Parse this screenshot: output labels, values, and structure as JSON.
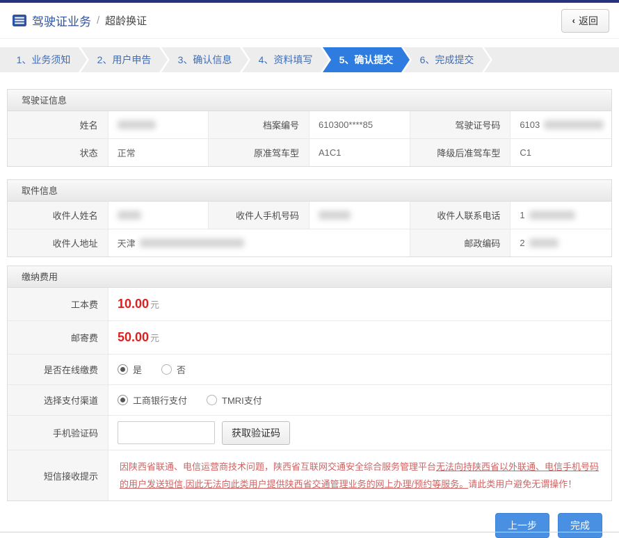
{
  "header": {
    "title": "驾驶证业务",
    "separator": "/",
    "subtitle": "超龄换证",
    "back_icon": "‹",
    "back_label": "返回"
  },
  "steps": [
    {
      "label": "1、业务须知",
      "active": false
    },
    {
      "label": "2、用户申告",
      "active": false
    },
    {
      "label": "3、确认信息",
      "active": false
    },
    {
      "label": "4、资料填写",
      "active": false
    },
    {
      "label": "5、确认提交",
      "active": true
    },
    {
      "label": "6、完成提交",
      "active": false
    }
  ],
  "license": {
    "title": "驾驶证信息",
    "name_label": "姓名",
    "file_no_label": "档案编号",
    "file_no_value": "610300****85",
    "license_no_label": "驾驶证号码",
    "license_no_prefix": "6103",
    "status_label": "状态",
    "status_value": "正常",
    "orig_class_label": "原准驾车型",
    "orig_class_value": "A1C1",
    "downgrade_class_label": "降级后准驾车型",
    "downgrade_class_value": "C1"
  },
  "pickup": {
    "title": "取件信息",
    "name_label": "收件人姓名",
    "mobile_label": "收件人手机号码",
    "phone_label": "收件人联系电话",
    "phone_prefix": "1",
    "address_label": "收件人地址",
    "address_prefix": "天津",
    "postcode_label": "邮政编码",
    "postcode_prefix": "2"
  },
  "payment": {
    "title": "缴纳费用",
    "fee_label": "工本费",
    "fee_value": "10.00",
    "fee_unit": "元",
    "postage_label": "邮寄费",
    "postage_value": "50.00",
    "postage_unit": "元",
    "online_label": "是否在线缴费",
    "online_yes": "是",
    "online_no": "否",
    "channel_label": "选择支付渠道",
    "channel_icbc": "工商银行支付",
    "channel_tmri": "TMRI支付",
    "captcha_label": "手机验证码",
    "captcha_value": "",
    "captcha_button": "获取验证码",
    "sms_label": "短信接收提示",
    "sms_part1": "因陕西省联通、电信运营商技术问题，陕西省互联网交通安全综合服务管理平台",
    "sms_part2": "无法向持陕西省以外联通、电信手机号码的用户发送短信,因此无法向此类用户提供陕西省交通管理业务的网上办理/预约等服务。",
    "sms_part3": "请此类用户避免无谓操作！"
  },
  "footer": {
    "prev_label": "上一步",
    "finish_label": "完成"
  },
  "colors": {
    "accent_blue": "#2e7ce0",
    "topbar_navy": "#283380",
    "fee_red": "#e01e1e",
    "notice_red": "#cf6464"
  }
}
